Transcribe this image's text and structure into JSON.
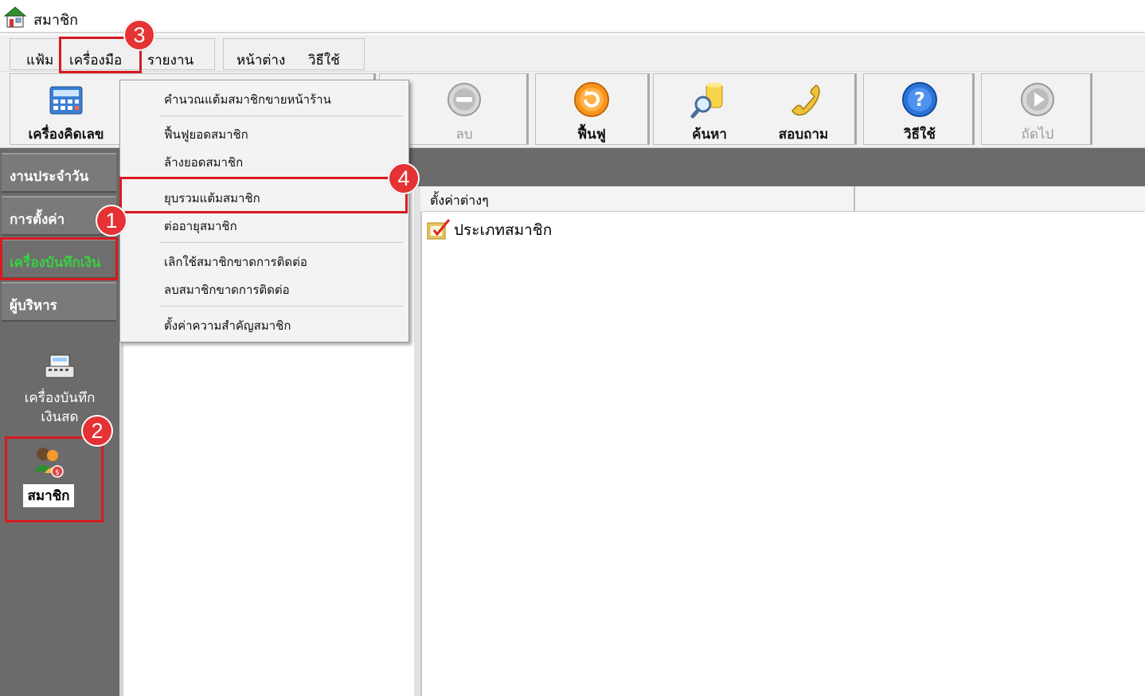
{
  "window": {
    "title": "สมาชิก",
    "icon": "shop-house-icon"
  },
  "menubar": {
    "items": [
      {
        "label": "แฟ้ม"
      },
      {
        "label": "เครื่องมือ"
      },
      {
        "label": "รายงาน"
      },
      {
        "label": "หน้าต่าง"
      },
      {
        "label": "วิธีใช้"
      }
    ]
  },
  "toolbar": {
    "buttons": [
      {
        "label": "เครื่องคิดเลข",
        "icon": "calculator-icon",
        "enabled": true
      },
      {
        "label": "ลบ",
        "icon": "minus-circle-icon",
        "enabled": false
      },
      {
        "label": "ฟื้นฟู",
        "icon": "restore-icon",
        "enabled": true
      },
      {
        "label": "ค้นหา",
        "icon": "search-icon",
        "enabled": true
      },
      {
        "label": "สอบถาม",
        "icon": "phone-icon",
        "enabled": true
      },
      {
        "label": "วิธีใช้",
        "icon": "help-icon",
        "enabled": true
      },
      {
        "label": "ถัดไป",
        "icon": "next-icon",
        "enabled": false
      }
    ]
  },
  "sidebar": {
    "sections": [
      {
        "label": "งานประจำวัน",
        "active": false
      },
      {
        "label": "การตั้งค่า",
        "active": false
      },
      {
        "label": "เครื่องบันทึกเงิน",
        "active": true
      },
      {
        "label": "ผู้บริหาร",
        "active": false
      }
    ],
    "items": [
      {
        "label_line1": "เครื่องบันทึก",
        "label_line2": "เงินสด",
        "icon": "cash-register-icon"
      },
      {
        "label": "สมาชิก",
        "icon": "members-icon"
      }
    ]
  },
  "dropdown": {
    "items": [
      "คำนวณแต้มสมาชิกขายหน้าร้าน",
      "ฟื้นฟูยอดสมาชิก",
      "ล้างยอดสมาชิก",
      "ยุบรวมแต้มสมาชิก",
      "ต่ออายุสมาชิก",
      "เลิกใช้สมาชิกขาดการติดต่อ",
      "ลบสมาชิกขาดการติดต่อ",
      "ตั้งค่าความสำคัญสมาชิก"
    ]
  },
  "list": {
    "column_header": "ตั้งค่าต่างๆ",
    "items": [
      {
        "label": "ประเภทสมาชิก",
        "icon": "checklist-icon"
      }
    ]
  },
  "annotations": {
    "step_badges": [
      "1",
      "2",
      "3",
      "4"
    ],
    "highlight_color": "#d71a1f",
    "badge_color": "#e53235"
  },
  "colors": {
    "active_section": "#39d13f",
    "panel_gray": "#6b6b6b"
  }
}
